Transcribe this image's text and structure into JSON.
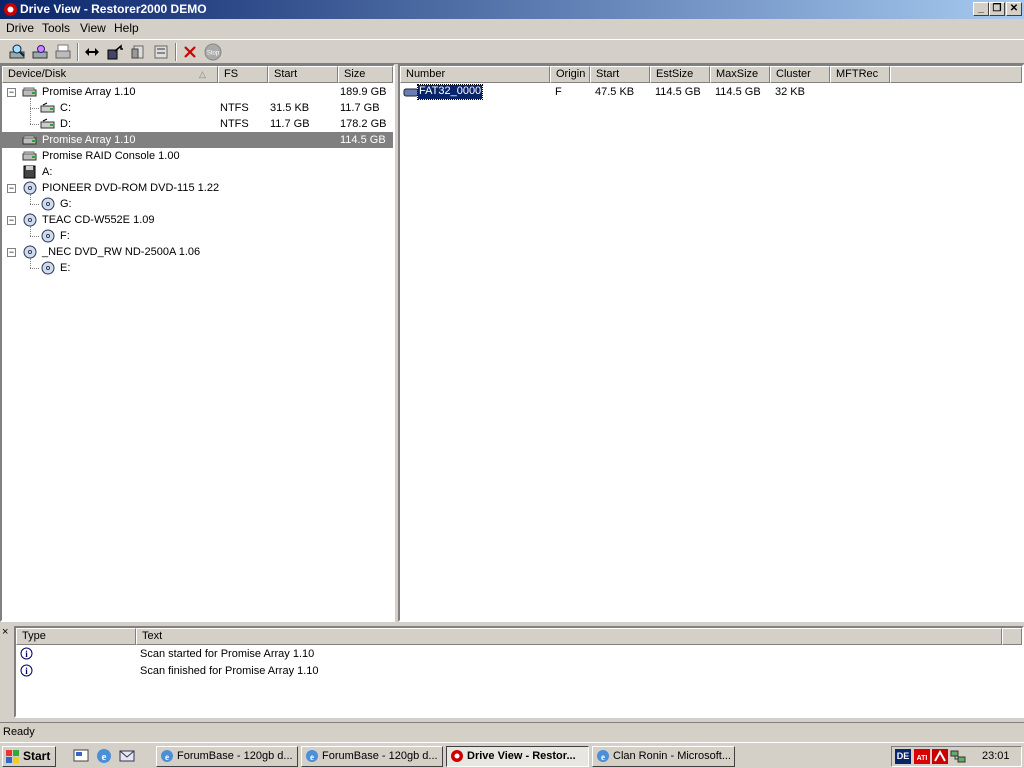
{
  "window": {
    "title": "Drive View - Restorer2000 DEMO",
    "minimize": "_",
    "maximize": "❐",
    "close": "✕"
  },
  "menu": [
    "Drive",
    "Tools",
    "View",
    "Help"
  ],
  "toolbar_icons": [
    "scan-icon",
    "find-icon",
    "print-icon",
    "swap-icon",
    "export-icon",
    "copy-icon",
    "paste-icon",
    "delete-icon",
    "stop-icon"
  ],
  "toolbar_stop_label": "Stop",
  "devices": {
    "columns": [
      "Device/Disk",
      "FS",
      "Start",
      "Size"
    ],
    "rows": [
      {
        "name": "Promise Array 1.10",
        "fs": "",
        "start": "",
        "size": "189.9 GB",
        "level": 0,
        "toggle": "−",
        "icon": "hdd-icon"
      },
      {
        "name": "C:",
        "fs": "NTFS",
        "start": "31.5 KB",
        "size": "11.7 GB",
        "level": 1,
        "toggle": "",
        "icon": "partition-icon"
      },
      {
        "name": "D:",
        "fs": "NTFS",
        "start": "11.7 GB",
        "size": "178.2 GB",
        "level": 1,
        "toggle": "",
        "icon": "partition-icon"
      },
      {
        "name": "Promise Array 1.10",
        "fs": "",
        "start": "",
        "size": "114.5 GB",
        "level": 0,
        "toggle": "",
        "icon": "hdd-icon",
        "selected": true
      },
      {
        "name": "Promise RAID Console 1.00",
        "fs": "",
        "start": "",
        "size": "",
        "level": 0,
        "toggle": "",
        "icon": "hdd-icon"
      },
      {
        "name": "A:",
        "fs": "",
        "start": "",
        "size": "",
        "level": 0,
        "toggle": "",
        "icon": "floppy-icon"
      },
      {
        "name": "PIONEER DVD-ROM DVD-115 1.22",
        "fs": "",
        "start": "",
        "size": "",
        "level": 0,
        "toggle": "−",
        "icon": "cdrom-icon"
      },
      {
        "name": "G:",
        "fs": "",
        "start": "",
        "size": "",
        "level": 1,
        "toggle": "",
        "icon": "cd-icon"
      },
      {
        "name": "TEAC CD-W552E 1.09",
        "fs": "",
        "start": "",
        "size": "",
        "level": 0,
        "toggle": "−",
        "icon": "cdrom-icon"
      },
      {
        "name": "F:",
        "fs": "",
        "start": "",
        "size": "",
        "level": 1,
        "toggle": "",
        "icon": "cd-icon"
      },
      {
        "name": "_NEC DVD_RW ND-2500A 1.06",
        "fs": "",
        "start": "",
        "size": "",
        "level": 0,
        "toggle": "−",
        "icon": "cdrom-icon"
      },
      {
        "name": "E:",
        "fs": "",
        "start": "",
        "size": "",
        "level": 1,
        "toggle": "",
        "icon": "cd-icon"
      }
    ]
  },
  "partitions": {
    "columns": [
      "Number",
      "Origin",
      "Start",
      "EstSize",
      "MaxSize",
      "Cluster",
      "MFTRec"
    ],
    "rows": [
      {
        "number": "FAT32_0000",
        "origin": "F",
        "start": "47.5 KB",
        "estsize": "114.5 GB",
        "maxsize": "114.5 GB",
        "cluster": "32 KB",
        "mftrec": ""
      }
    ]
  },
  "log": {
    "columns": [
      "Type",
      "Text"
    ],
    "rows": [
      {
        "type": "info-icon",
        "text": "Scan started for Promise Array 1.10"
      },
      {
        "type": "info-icon",
        "text": "Scan finished for Promise Array 1.10"
      }
    ],
    "close": "×"
  },
  "status": "Ready",
  "taskbar": {
    "start": "Start",
    "tasks": [
      {
        "label": "ForumBase - 120gb d...",
        "active": false
      },
      {
        "label": "ForumBase - 120gb d...",
        "active": false
      },
      {
        "label": "Drive View - Restor...",
        "active": true
      },
      {
        "label": "Clan Ronin - Microsoft...",
        "active": false
      }
    ],
    "tray_lang": "DE",
    "clock": "23:01"
  },
  "colors": {
    "title_start": "#0a246a",
    "title_end": "#a6caf0",
    "face": "#d4d0c8",
    "selection": "#808080",
    "highlight": "#0a246a"
  }
}
